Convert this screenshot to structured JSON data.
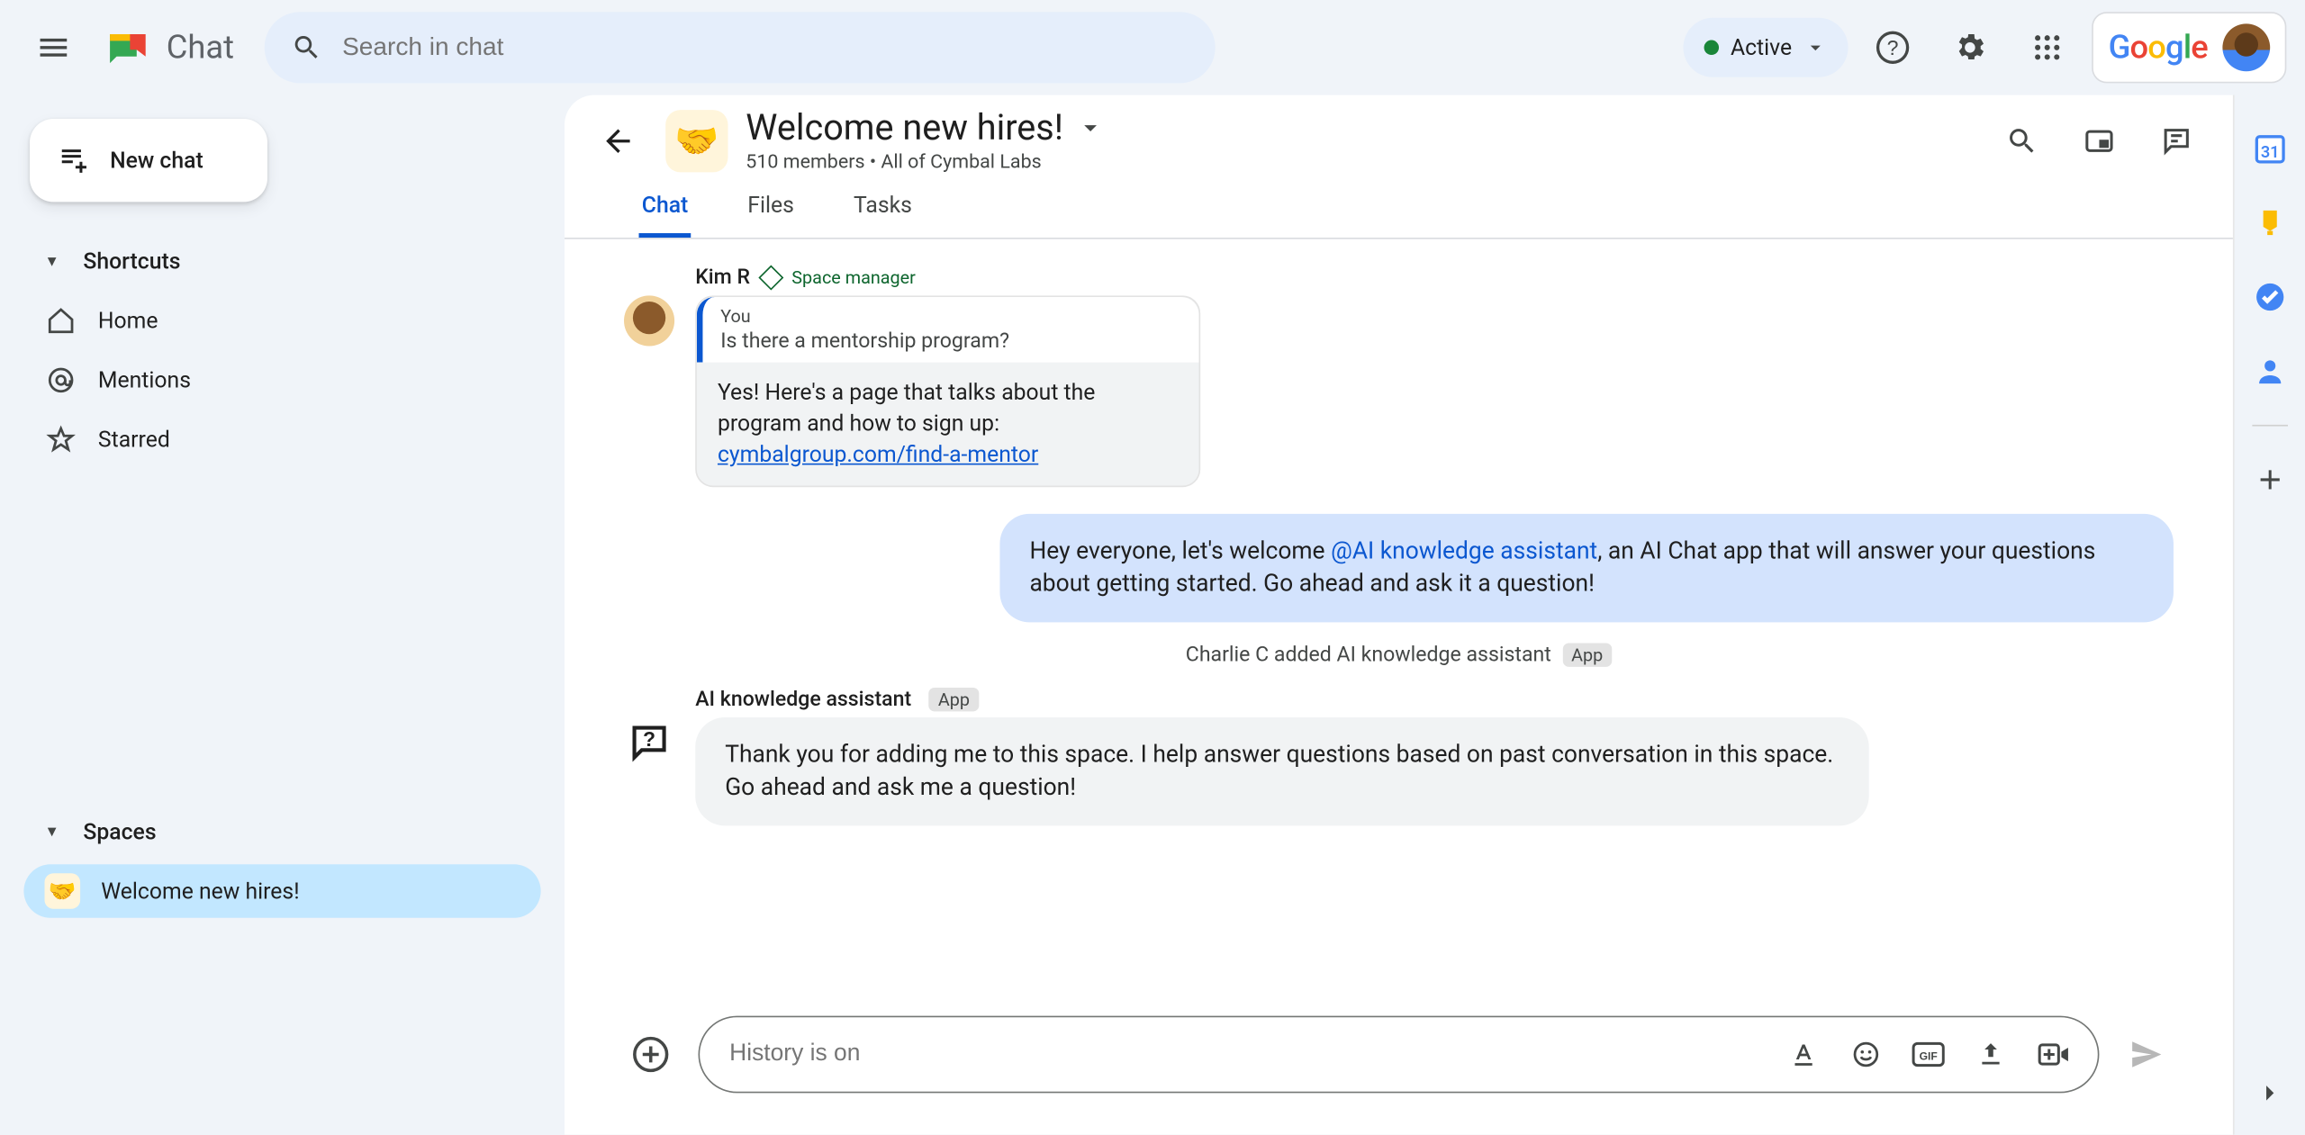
{
  "header": {
    "product_name": "Chat",
    "search_placeholder": "Search in chat",
    "status_label": "Active",
    "google_logo_letters": [
      "G",
      "o",
      "o",
      "g",
      "l",
      "e"
    ]
  },
  "leftnav": {
    "new_chat_label": "New chat",
    "shortcuts_label": "Shortcuts",
    "shortcut_items": {
      "home": "Home",
      "mentions": "Mentions",
      "starred": "Starred"
    },
    "spaces_label": "Spaces",
    "spaces": {
      "welcome": "Welcome new hires!"
    }
  },
  "space": {
    "title": "Welcome new hires!",
    "subtitle": "510 members  •  All of Cymbal Labs",
    "tabs": {
      "chat": "Chat",
      "files": "Files",
      "tasks": "Tasks"
    }
  },
  "messages": {
    "kim": {
      "name": "Kim R",
      "role": "Space manager",
      "quoted_author": "You",
      "quoted_text": "Is there a mentorship program?",
      "reply_pre": "Yes! Here's a page that talks about the program and how to sign up: ",
      "reply_link": "cymbalgroup.com/find-a-mentor"
    },
    "announce": {
      "pre": "Hey everyone, let's welcome ",
      "mention": "@AI knowledge assistant",
      "post": ", an AI Chat app that will answer your questions about getting started.  Go ahead and ask it a question!"
    },
    "system_added": "Charlie C added AI knowledge assistant",
    "app_chip": "App",
    "ai": {
      "name": "AI knowledge assistant",
      "text": "Thank you for adding me to this space. I help answer questions based on past conversation in this space. Go ahead and ask me a question!"
    }
  },
  "composer": {
    "placeholder": "History is on"
  }
}
